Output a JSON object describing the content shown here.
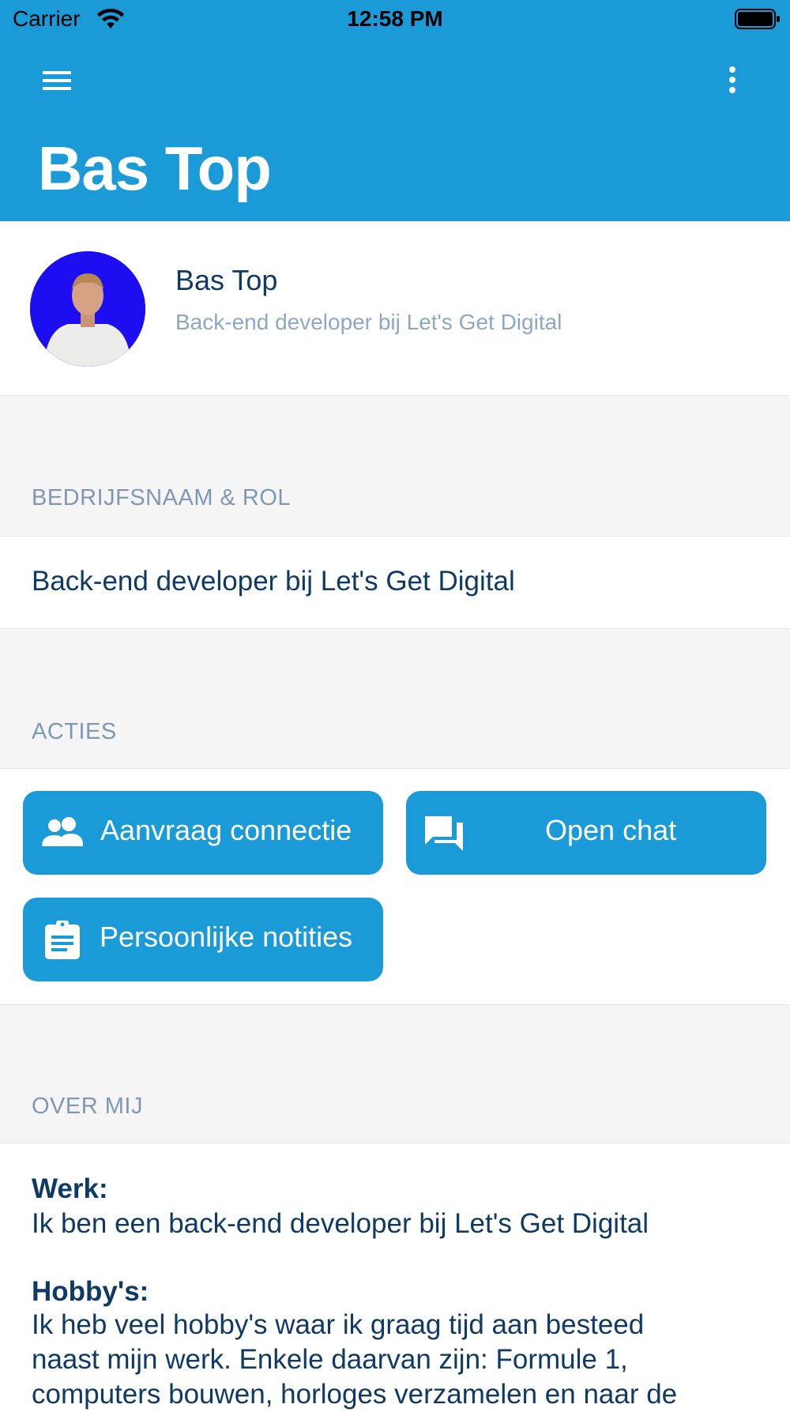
{
  "status_bar": {
    "carrier": "Carrier",
    "time": "12:58 PM"
  },
  "header": {
    "title": "Bas Top",
    "menu_icon": "hamburger-menu-icon",
    "more_icon": "more-vertical-icon",
    "background": "#1a9bd7"
  },
  "profile": {
    "name": "Bas Top",
    "subtitle": "Back-end developer bij Let's Get Digital",
    "avatar_bg": "#1c0ef0"
  },
  "company_section": {
    "label": "BEDRIJFSNAAM & ROL",
    "value": "Back-end developer bij Let's Get Digital"
  },
  "actions_section": {
    "label": "ACTIES",
    "buttons": [
      {
        "label": "Aanvraag connectie",
        "icon": "people-icon"
      },
      {
        "label": "Open chat",
        "icon": "chat-icon"
      },
      {
        "label": "Persoonlijke notities",
        "icon": "clipboard-icon"
      }
    ]
  },
  "about_section": {
    "label": "OVER MIJ",
    "work_title": "Werk:",
    "work_text": "Ik ben een back-end developer bij Let's Get Digital",
    "hobby_title": "Hobby's:",
    "hobby_lines": [
      "Ik heb veel hobby's waar ik graag tijd aan besteed",
      "naast mijn werk. Enkele daarvan zijn: Formule 1,",
      "computers bouwen, horloges verzamelen en naar de"
    ]
  }
}
